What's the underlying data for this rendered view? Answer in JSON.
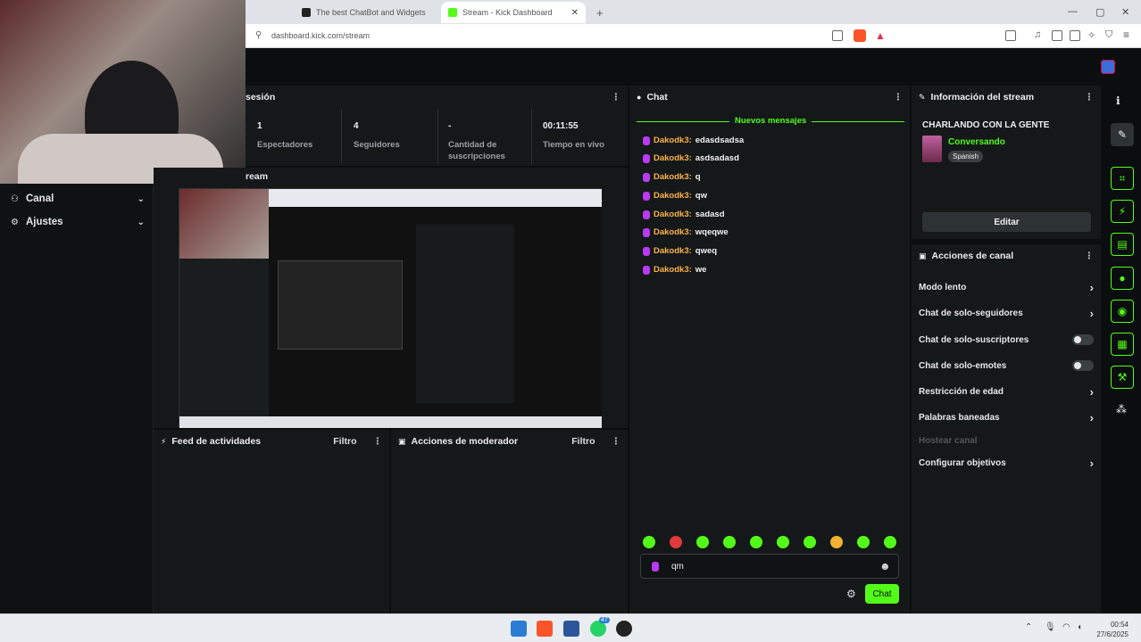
{
  "browser": {
    "tabs": [
      {
        "title": "The best ChatBot and Widgets for Ki",
        "active": false
      },
      {
        "title": "Stream - Kick Dashboard",
        "active": true
      }
    ],
    "new_tab": "+",
    "url": "dashboard.kick.com/stream",
    "window_controls": [
      "—",
      "▢",
      "✕"
    ]
  },
  "nav": {
    "items": [
      {
        "label": "Canal",
        "icon": "users-icon"
      },
      {
        "label": "Ajustes",
        "icon": "gear-icon"
      }
    ]
  },
  "session": {
    "title": "sesión",
    "stats": [
      {
        "value": "1",
        "label": "Espectadores"
      },
      {
        "value": "4",
        "label": "Seguidores"
      },
      {
        "value": "-",
        "label": "Cantidad de suscripciones"
      },
      {
        "value": "00:11:55",
        "label": "Tiempo en vivo"
      }
    ]
  },
  "preview": {
    "title": "ream"
  },
  "feed": {
    "title": "Feed de actividades",
    "filter": "Filtro"
  },
  "modactions": {
    "title": "Acciones de moderador",
    "filter": "Filtro"
  },
  "chat": {
    "title": "Chat",
    "new_messages": "Nuevos mensajes",
    "messages": [
      {
        "user": "Dakodk3:",
        "text": "edasdsadsa"
      },
      {
        "user": "Dakodk3:",
        "text": "asdsadasd"
      },
      {
        "user": "Dakodk3:",
        "text": "q"
      },
      {
        "user": "Dakodk3:",
        "text": "qw"
      },
      {
        "user": "Dakodk3:",
        "text": "sadasd"
      },
      {
        "user": "Dakodk3:",
        "text": "wqeqwe"
      },
      {
        "user": "Dakodk3:",
        "text": "qweq"
      },
      {
        "user": "Dakodk3:",
        "text": "we"
      }
    ],
    "input_value": "qm",
    "send_label": "Chat"
  },
  "stream_info": {
    "title": "Información del stream",
    "stream_title": "CHARLANDO CON LA GENTE",
    "category": "Conversando",
    "language": "Spanish",
    "edit_label": "Editar"
  },
  "channel_actions": {
    "title": "Acciones de canal",
    "items": [
      {
        "label": "Modo lento",
        "control": "chevron"
      },
      {
        "label": "Chat de solo-seguidores",
        "control": "chevron"
      },
      {
        "label": "Chat de solo-suscriptores",
        "control": "toggle"
      },
      {
        "label": "Chat de solo-emotes",
        "control": "toggle"
      },
      {
        "label": "Restricción de edad",
        "control": "chevron"
      },
      {
        "label": "Palabras baneadas",
        "control": "chevron"
      },
      {
        "label": "Hostear canal",
        "control": "disabled"
      },
      {
        "label": "Configurar objetivos",
        "control": "chevron"
      }
    ]
  },
  "taskbar": {
    "time": "00:54",
    "date": "27/6/2025",
    "badge": "47"
  },
  "colors": {
    "accent": "#53fc18",
    "username": "#ffb347",
    "badge": "#b93af0",
    "panel": "#141819",
    "background": "#0b0e0f"
  }
}
